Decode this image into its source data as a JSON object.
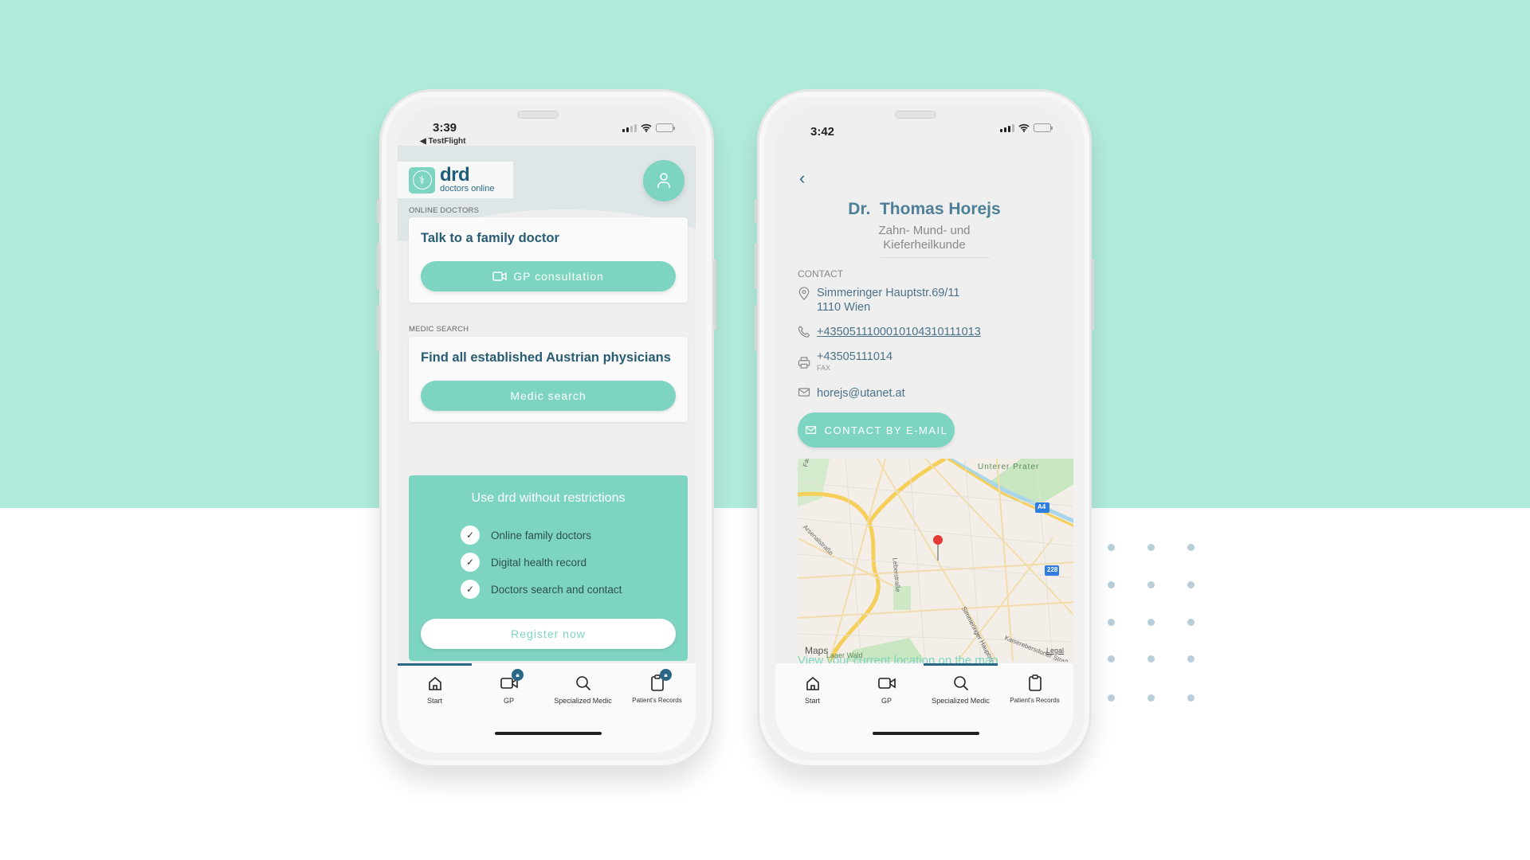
{
  "background": {
    "top_color": "#b1ebdb",
    "bottom_color": "#ffffff",
    "dot_color": "#b8ced8"
  },
  "phone_left": {
    "status": {
      "time": "3:39",
      "back_app": "◀ TestFlight"
    },
    "logo": {
      "name": "drd",
      "tagline": "doctors online"
    },
    "sections": [
      {
        "label": "ONLINE DOCTORS",
        "card_title": "Talk to a family doctor",
        "button_label": "GP consultation",
        "button_icon": "video-camera-icon"
      },
      {
        "label": "MEDIC SEARCH",
        "card_title": "Find all established Austrian physicians",
        "button_label": "Medic search"
      }
    ],
    "promo": {
      "title": "Use drd without restrictions",
      "features": [
        "Online family doctors",
        "Digital health record",
        "Doctors search and contact"
      ],
      "cta_label": "Register now"
    },
    "tabs": [
      {
        "label": "Start",
        "icon": "home-icon",
        "locked": false,
        "active": true
      },
      {
        "label": "GP",
        "icon": "video-camera-icon",
        "locked": true,
        "active": false
      },
      {
        "label": "Specialized Medic",
        "icon": "search-icon",
        "locked": false,
        "active": false
      },
      {
        "label": "Patient's Records",
        "icon": "clipboard-icon",
        "locked": true,
        "active": false
      }
    ]
  },
  "phone_right": {
    "status": {
      "time": "3:42"
    },
    "doctor": {
      "title": "Dr.",
      "name": "Thomas Horejs",
      "specialty_line1": "Zahn- Mund- und",
      "specialty_line2": "Kieferheilkunde"
    },
    "contact_label": "CONTACT",
    "address_line1": "Simmeringer Hauptstr.69/11",
    "address_line2": "1110 Wien",
    "phone": "+4350511100010104310111013",
    "fax": "+43505111014",
    "fax_label": "FAX",
    "email": "horejs@utanet.at",
    "email_button": "CONTACT BY E-MAIL",
    "map": {
      "labels": [
        "Unterer Prater",
        "Arsenalstraße",
        "Leberstraße",
        "Simmeringer Hauptstr.",
        "Kaiserebersdorfer Straße",
        "Laaer Wald",
        "Fasangasse"
      ],
      "shields": [
        "A4",
        "228"
      ],
      "attribution": "Maps",
      "legal": "Legal"
    },
    "view_location": "View your current location on the map",
    "tabs": [
      {
        "label": "Start",
        "icon": "home-icon"
      },
      {
        "label": "GP",
        "icon": "video-camera-icon"
      },
      {
        "label": "Specialized Medic",
        "icon": "search-icon"
      },
      {
        "label": "Patient's Records",
        "icon": "clipboard-icon"
      }
    ]
  }
}
